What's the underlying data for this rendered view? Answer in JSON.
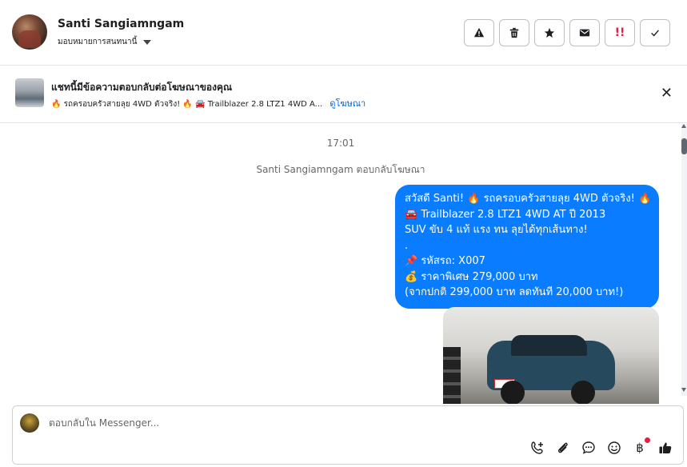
{
  "header": {
    "contact_name": "Santi Sangiamngam",
    "assign_label": "มอบหมายการสนทนานี้",
    "actions": [
      {
        "icon": "warning-icon"
      },
      {
        "icon": "trash-icon"
      },
      {
        "icon": "star-icon"
      },
      {
        "icon": "mail-icon"
      },
      {
        "icon": "follow-up-icon",
        "glyph": "!!"
      },
      {
        "icon": "check-icon"
      }
    ]
  },
  "ad_banner": {
    "title": "แชทนี้มีข้อความตอบกลับต่อโฆษณาของคุณ",
    "subtitle": "🔥 รถครอบครัวสายลุย 4WD ตัวจริง! 🔥 🚘 Trailblazer 2.8 LTZ1 4WD A...",
    "link": "ดูโฆษณา"
  },
  "chat": {
    "timestamp": "17:01",
    "reply_note": "Santi Sangiamngam ตอบกลับโฆษณา",
    "message_lines": [
      "สวัสดี Santi! 🔥 รถครอบครัวสายลุย 4WD ตัวจริง! 🔥",
      "🚘 Trailblazer 2.8 LTZ1 4WD AT ปี 2013",
      "SUV ขับ 4 แท้ แรง ทน ลุยได้ทุกเส้นทาง!",
      ".",
      "📌 รหัสรถ: X007",
      "💰 ราคาพิเศษ 279,000 บาท",
      "(จากปกติ 299,000 บาท ลดทันที 20,000 บาท!)"
    ]
  },
  "composer": {
    "placeholder": "ตอบกลับใน Messenger...",
    "tools": [
      "add-contact-icon",
      "attachment-icon",
      "saved-reply-icon",
      "emoji-icon",
      "payment-icon",
      "thumbs-up-icon"
    ],
    "payment_glyph": "฿"
  },
  "colors": {
    "bubble": "#0a7cff",
    "link": "#0064d1",
    "badge": "#e41e3f"
  }
}
